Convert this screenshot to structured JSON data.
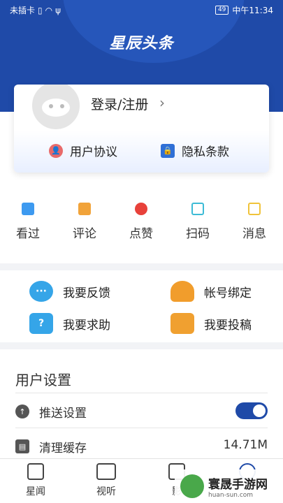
{
  "status_bar": {
    "left_text": "未插卡",
    "battery": "49",
    "time": "中午11:34"
  },
  "header": {
    "brand": "星辰头条"
  },
  "profile": {
    "login_label": "登录/注册",
    "chevron": "›",
    "user_agreement": "用户协议",
    "privacy_policy": "隐私条款"
  },
  "quick_actions": [
    {
      "label": "看过",
      "icon": "document-icon",
      "color": "#3d9af0"
    },
    {
      "label": "评论",
      "icon": "comment-icon",
      "color": "#f1a33a"
    },
    {
      "label": "点赞",
      "icon": "heart-icon",
      "color": "#e8413a"
    },
    {
      "label": "扫码",
      "icon": "scan-icon",
      "color": "#3dbbd6"
    },
    {
      "label": "消息",
      "icon": "edit-icon",
      "color": "#f0c33a"
    }
  ],
  "services": [
    {
      "label": "我要反馈",
      "icon": "chat-bubble-icon",
      "color": "#35a5e8",
      "glyph": "···"
    },
    {
      "label": "帐号绑定",
      "icon": "user-link-icon",
      "color": "#f19d2c",
      "glyph": ""
    },
    {
      "label": "我要求助",
      "icon": "help-icon",
      "color": "#35a5e8",
      "glyph": "?"
    },
    {
      "label": "我要投稿",
      "icon": "envelope-icon",
      "color": "#f0a030",
      "glyph": ""
    }
  ],
  "settings": {
    "title": "用户设置",
    "push_label": "推送设置",
    "push_enabled": true,
    "cache_label": "清理缓存",
    "cache_value": "14.71M"
  },
  "tabs": [
    {
      "label": "星闻",
      "icon": "news-icon"
    },
    {
      "label": "视听",
      "icon": "video-icon"
    },
    {
      "label": "影",
      "icon": "image-icon"
    },
    {
      "label": "",
      "icon": "star-icon"
    }
  ],
  "watermark": {
    "name": "寰晟手游网",
    "url": "huan-sun.com"
  },
  "colors": {
    "primary": "#1f4aa8",
    "divider": "#f2f3f6"
  }
}
